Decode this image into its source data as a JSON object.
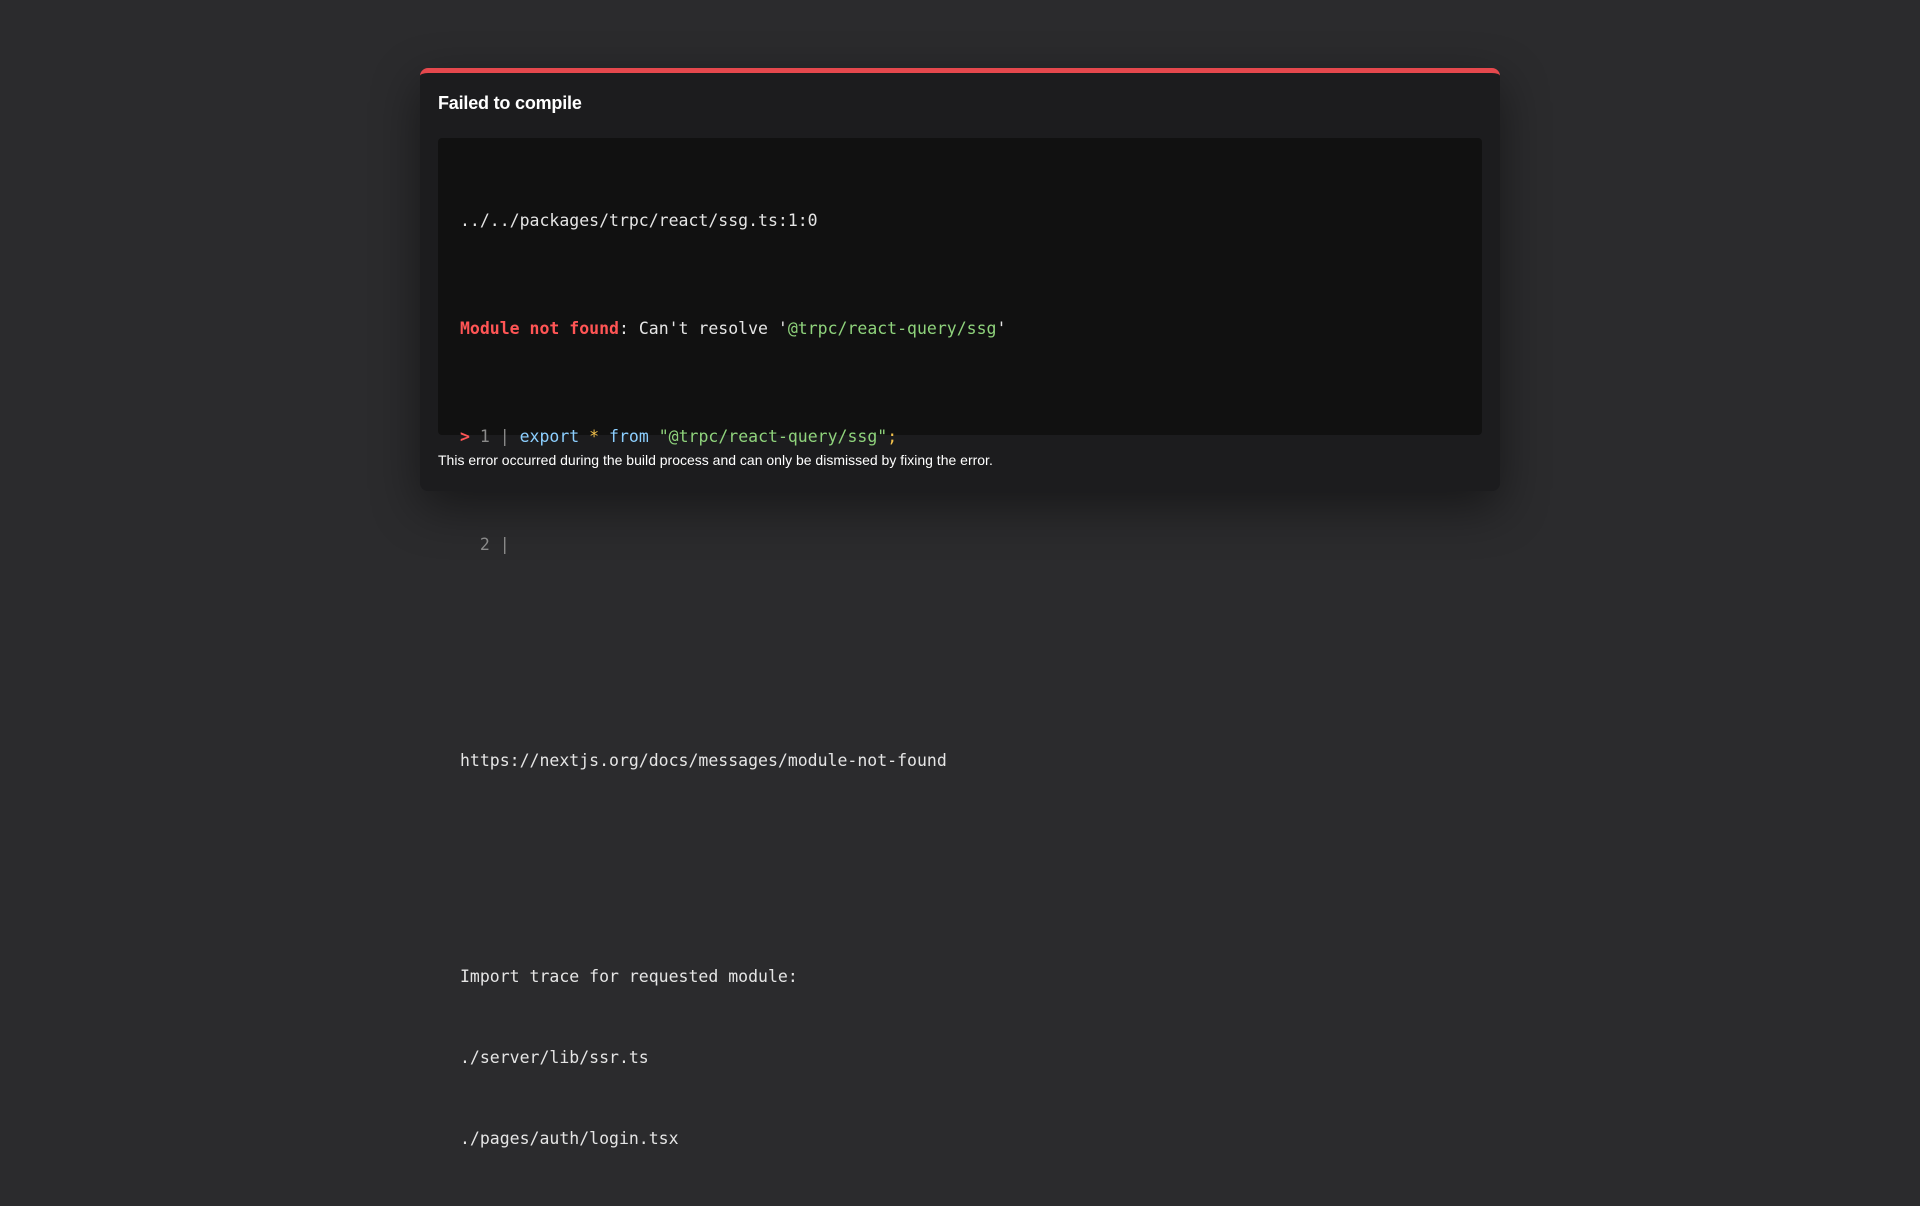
{
  "dialog": {
    "title": "Failed to compile",
    "source_location": "../../packages/trpc/react/ssg.ts:1:0",
    "error": {
      "label": "Module not found",
      "separator": ":",
      "message": " Can't resolve '",
      "module": "@trpc/react-query/ssg",
      "quote_close": "'"
    },
    "code_lines": [
      {
        "marker": ">",
        "number": "1",
        "gutter": "|",
        "kw_export": "export",
        "star": "*",
        "kw_from": "from",
        "string": "\"@trpc/react-query/ssg\"",
        "semicolon": ";"
      },
      {
        "marker": "",
        "number": "2",
        "gutter": "|"
      }
    ],
    "docs_link": "https://nextjs.org/docs/messages/module-not-found",
    "trace_heading": "Import trace for requested module:",
    "trace": [
      "./server/lib/ssr.ts",
      "./pages/auth/login.tsx"
    ],
    "footer": "This error occurred during the build process and can only be dismissed by fixing the error."
  },
  "colors": {
    "accent": "#e5484d",
    "background": "#2b2b2d",
    "dialog": "#1c1c1e",
    "code_bg": "#111111",
    "error_text": "#ff5555",
    "string": "#8fd37c",
    "keyword": "#8ccfff",
    "operator": "#f3c14b"
  }
}
